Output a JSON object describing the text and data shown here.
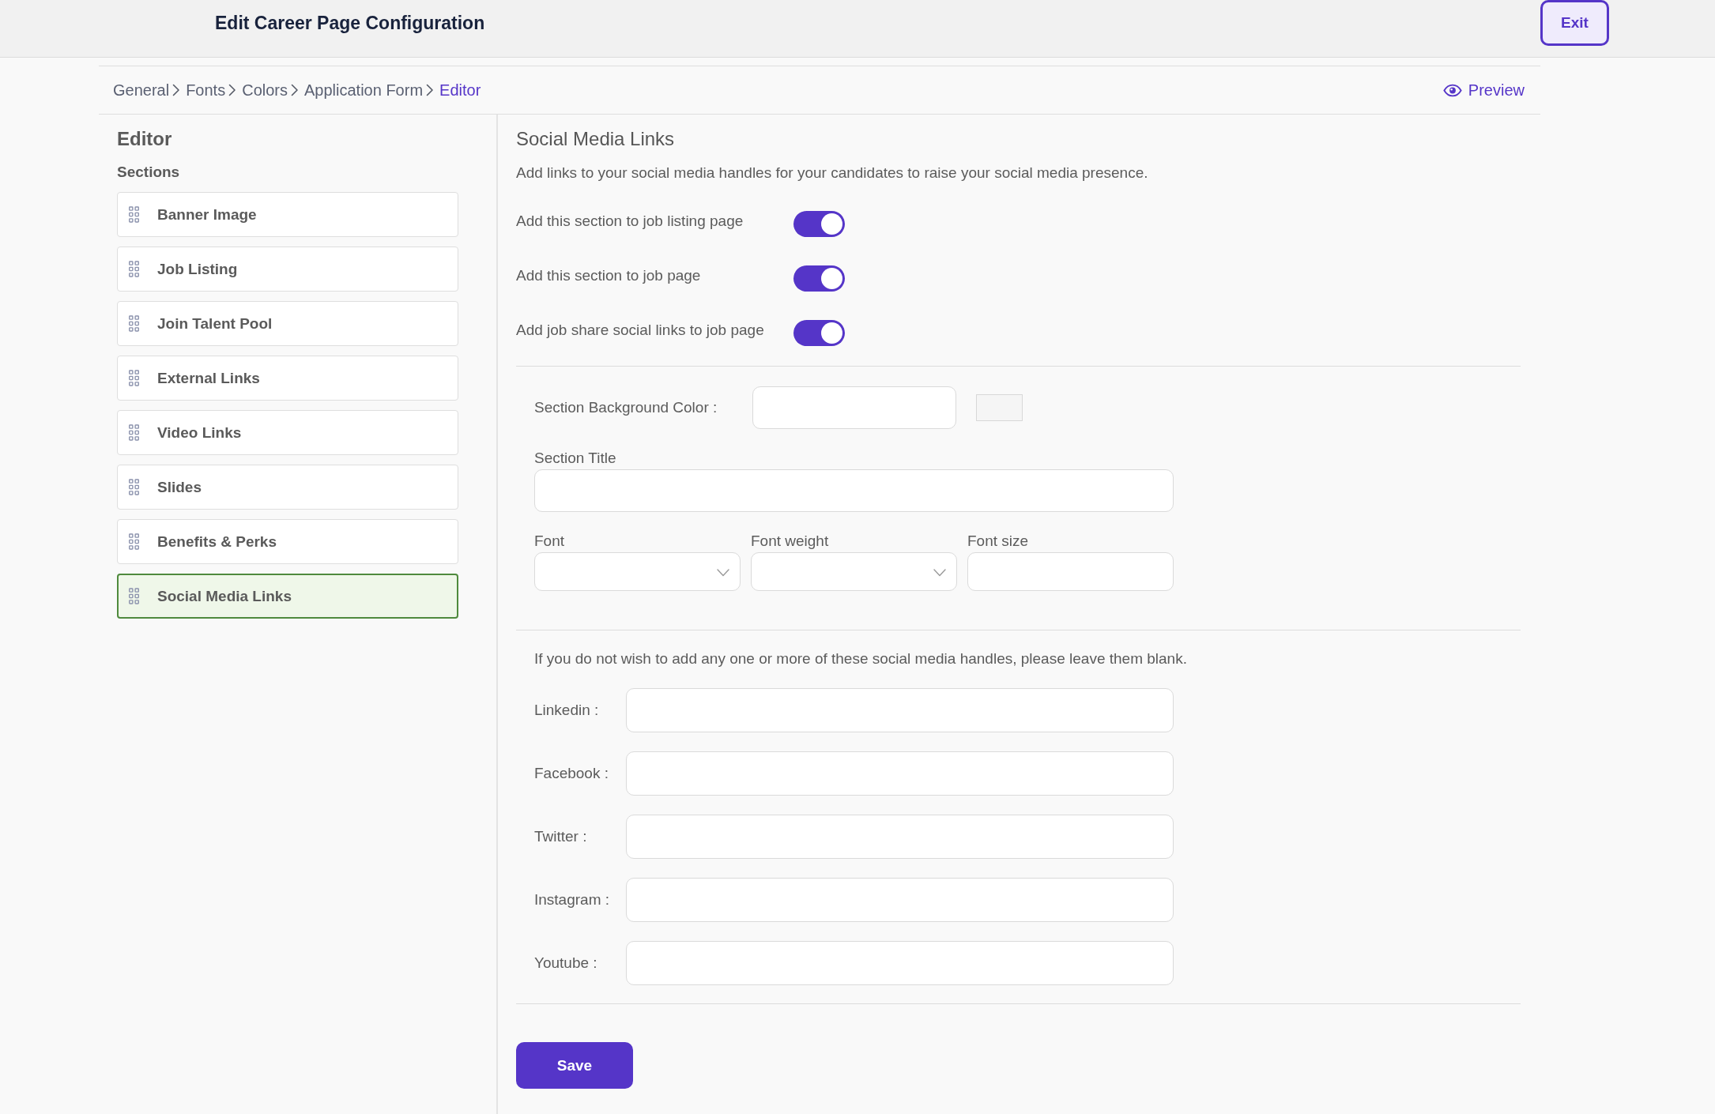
{
  "header": {
    "title": "Edit Career Page Configuration",
    "exit_button": "Exit"
  },
  "breadcrumb": [
    {
      "label": "General",
      "selected": false
    },
    {
      "label": "Fonts",
      "selected": false
    },
    {
      "label": "Colors",
      "selected": false
    },
    {
      "label": "Application Form",
      "selected": false
    },
    {
      "label": "Editor",
      "selected": true
    }
  ],
  "preview_link": "Preview",
  "sidebar": {
    "title": "Editor",
    "subtitle": "Sections",
    "items": [
      {
        "label": "Banner Image",
        "selected": false
      },
      {
        "label": "Job Listing",
        "selected": false
      },
      {
        "label": "Join Talent Pool",
        "selected": false
      },
      {
        "label": "External Links",
        "selected": false
      },
      {
        "label": "Video Links",
        "selected": false
      },
      {
        "label": "Slides",
        "selected": false
      },
      {
        "label": "Benefits & Perks",
        "selected": false
      },
      {
        "label": "Social Media Links",
        "selected": true
      }
    ]
  },
  "panel": {
    "title": "Social Media Links",
    "description": "Add links to your social media handles for your candidates to raise your social media presence.",
    "toggles": [
      {
        "label": "Add this section to job listing page",
        "on": true
      },
      {
        "label": "Add this section to job page",
        "on": true
      },
      {
        "label": "Add job share social links to job page",
        "on": true
      }
    ],
    "background_color": {
      "label": "Section Background Color :"
    },
    "section_title": {
      "label": "Section Title"
    },
    "font_fields": [
      {
        "label": "Font",
        "kind": "select"
      },
      {
        "label": "Font weight",
        "kind": "select"
      },
      {
        "label": "Font size",
        "kind": "text"
      }
    ],
    "note": "If you do not wish to add any one or more of these social media handles, please leave them blank.",
    "social_fields": [
      {
        "label": "Linkedin :"
      },
      {
        "label": "Facebook :"
      },
      {
        "label": "Twitter :"
      },
      {
        "label": "Instagram :"
      },
      {
        "label": "Youtube :"
      }
    ],
    "save_button": "Save"
  }
}
